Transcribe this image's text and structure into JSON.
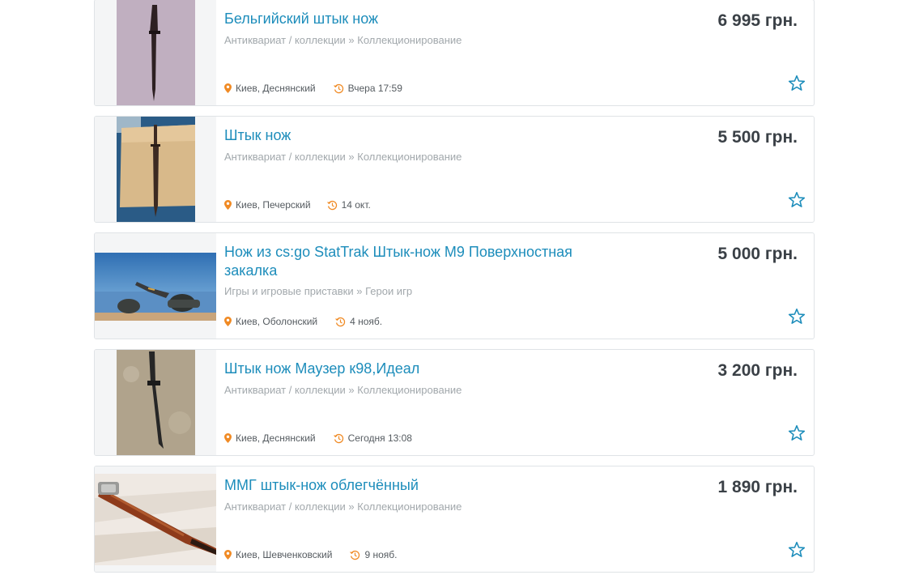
{
  "listings": [
    {
      "title": "Бельгийский штык нож",
      "category": "Антиквариат / коллекции » Коллекционирование",
      "price": "6 995 грн.",
      "location": "Киев, Деснянский",
      "date": "Вчера 17:59"
    },
    {
      "title": "Штык нож",
      "category": "Антиквариат / коллекции » Коллекционирование",
      "price": "5 500 грн.",
      "location": "Киев, Печерский",
      "date": "14 окт."
    },
    {
      "title": "Нож из cs:go StatTrak Штык-нож M9 Поверхностная закалка",
      "category": "Игры и игровые приставки » Герои игр",
      "price": "5 000 грн.",
      "location": "Киев, Оболонский",
      "date": "4 нояб."
    },
    {
      "title": "Штык нож Маузер к98,Идеал",
      "category": "Антиквариат / коллекции » Коллекционирование",
      "price": "3 200 грн.",
      "location": "Киев, Деснянский",
      "date": "Сегодня 13:08"
    },
    {
      "title": "ММГ штык-нож облегчённый",
      "category": "Антиквариат / коллекции » Коллекционирование",
      "price": "1 890 грн.",
      "location": "Киев, Шевченковский",
      "date": "9 нояб."
    }
  ],
  "icons": {
    "location": "map-pin-icon",
    "date": "history-clock-icon",
    "favorite": "star-outline-icon"
  },
  "colors": {
    "title": "#1d8dbb",
    "price": "#3a4046",
    "pin": "#f08a24",
    "star": "#1d8dbb"
  }
}
